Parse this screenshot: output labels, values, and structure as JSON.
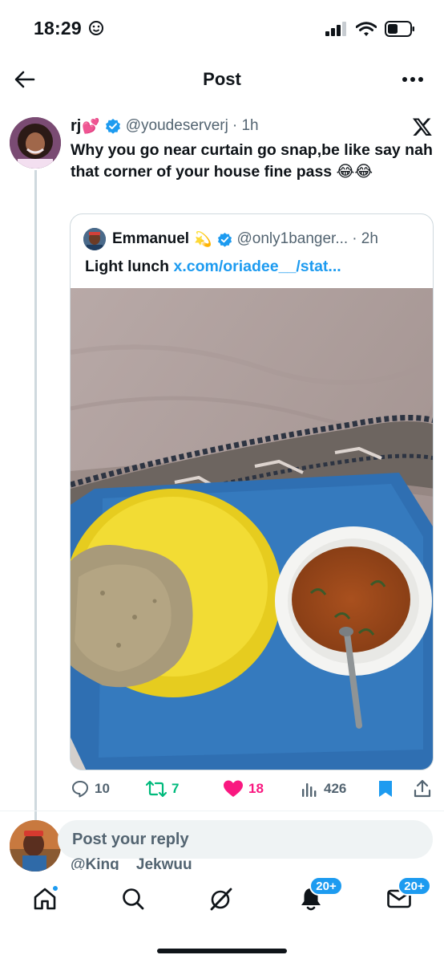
{
  "status_bar": {
    "time": "18:29"
  },
  "header": {
    "title": "Post"
  },
  "post": {
    "author_name": "rj",
    "author_emoji": "💕",
    "handle": "@youdeserverj",
    "time": "· 1h",
    "text": "Why you go near curtain go snap,be like say nah that corner of your house fine pass 😂😂",
    "quote": {
      "author_name": "Emmanuel",
      "author_emoji": "💫",
      "handle": "@only1banger...",
      "time": "· 2h",
      "text": "Light lunch",
      "link": "x.com/oriadee__/stat..."
    },
    "stats": {
      "replies": "10",
      "reposts": "7",
      "likes": "18",
      "views": "426"
    }
  },
  "reply": {
    "placeholder": "Post your reply",
    "peek_text": "@King__Jekwuu"
  },
  "bottom_nav": {
    "notifications_badge": "20+",
    "messages_badge": "20+"
  },
  "colors": {
    "accent": "#1d9bf0",
    "repost_green": "#00ba7c",
    "like_pink": "#f91880",
    "muted": "#536471"
  }
}
